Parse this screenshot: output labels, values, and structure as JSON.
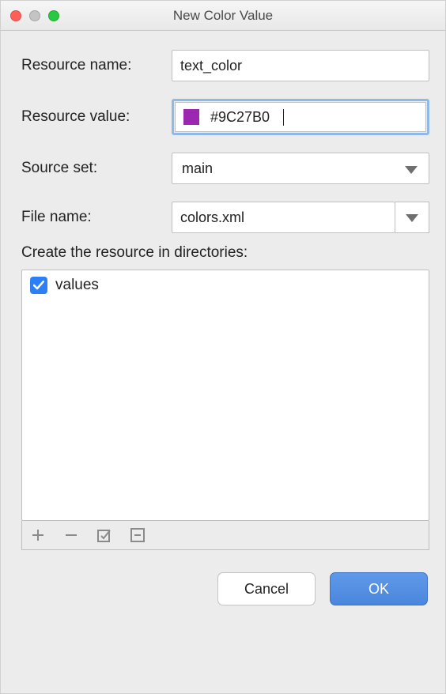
{
  "window": {
    "title": "New Color Value"
  },
  "form": {
    "resource_name": {
      "label": "Resource name:",
      "value": "text_color"
    },
    "resource_value": {
      "label": "Resource value:",
      "value": "#9C27B0",
      "swatch_color": "#9C27B0"
    },
    "source_set": {
      "label": "Source set:",
      "value": "main"
    },
    "file_name": {
      "label": "File name:",
      "value": "colors.xml"
    },
    "directories": {
      "label": "Create the resource in directories:",
      "items": [
        {
          "label": "values",
          "checked": true
        }
      ]
    }
  },
  "footer": {
    "cancel": "Cancel",
    "ok": "OK"
  }
}
